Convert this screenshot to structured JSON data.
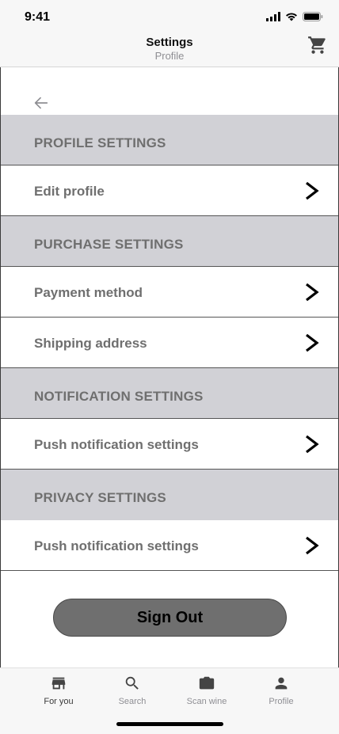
{
  "status_bar": {
    "time": "9:41"
  },
  "header": {
    "title": "Settings",
    "subtitle": "Profile"
  },
  "sections": [
    {
      "title": "PROFILE SETTINGS",
      "items": [
        "Edit profile"
      ]
    },
    {
      "title": "PURCHASE SETTINGS",
      "items": [
        "Payment method",
        "Shipping address"
      ]
    },
    {
      "title": "NOTIFICATION SETTINGS",
      "items": [
        "Push notification settings"
      ]
    },
    {
      "title": "PRIVACY SETTINGS",
      "items": [
        "Push notification settings"
      ]
    }
  ],
  "actions": {
    "sign_out": "Sign Out"
  },
  "tabbar": {
    "active": "For you",
    "tabs": [
      {
        "label": "For you",
        "icon": "store-icon"
      },
      {
        "label": "Search",
        "icon": "search-icon"
      },
      {
        "label": "Scan wine",
        "icon": "camera-icon"
      },
      {
        "label": "Profile",
        "icon": "person-icon"
      }
    ]
  },
  "colors": {
    "section_bg": "#d1d1d6",
    "button_bg": "#6f6f6f",
    "text_muted": "#6f6f6f"
  }
}
